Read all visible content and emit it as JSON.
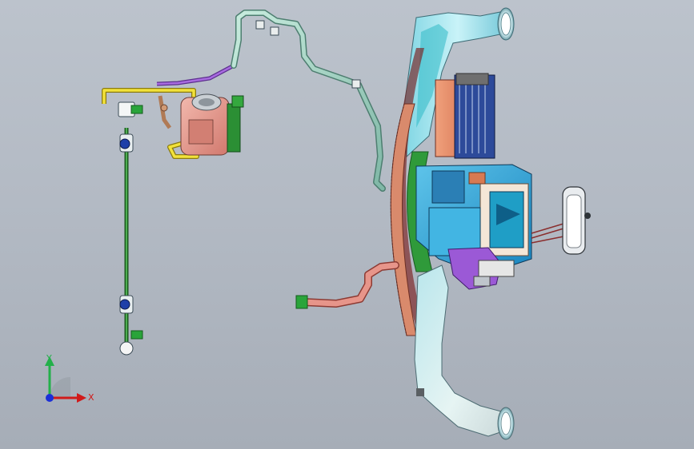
{
  "viewport": {
    "background_top": "#bcc3cc",
    "background_bottom": "#a6adb7"
  },
  "model": {
    "components": [
      "hvac-air-duct-assembly",
      "heater-core",
      "evaporator-core",
      "blower-motor",
      "air-inlet-duct",
      "air-outlet-duct",
      "refrigerant-line",
      "ac-compressor",
      "receiver-drier-bracket",
      "drain-hose"
    ],
    "colors": {
      "duct": "#a8e6ef",
      "housing": "#2fa8d8",
      "heater": "#e07a55",
      "compressor": "#e6a39a",
      "pipe": "#9fd1c6",
      "line_yellow": "#f2e23a",
      "line_purple": "#9a56d6",
      "bracket_green": "#1f8a2e",
      "flange": "#d79a7b"
    }
  },
  "triad": {
    "x_label": "X",
    "y_label": "Y",
    "x_color": "#d11a1a",
    "y_color": "#23b04a",
    "z_color": "#1b2fd8"
  }
}
